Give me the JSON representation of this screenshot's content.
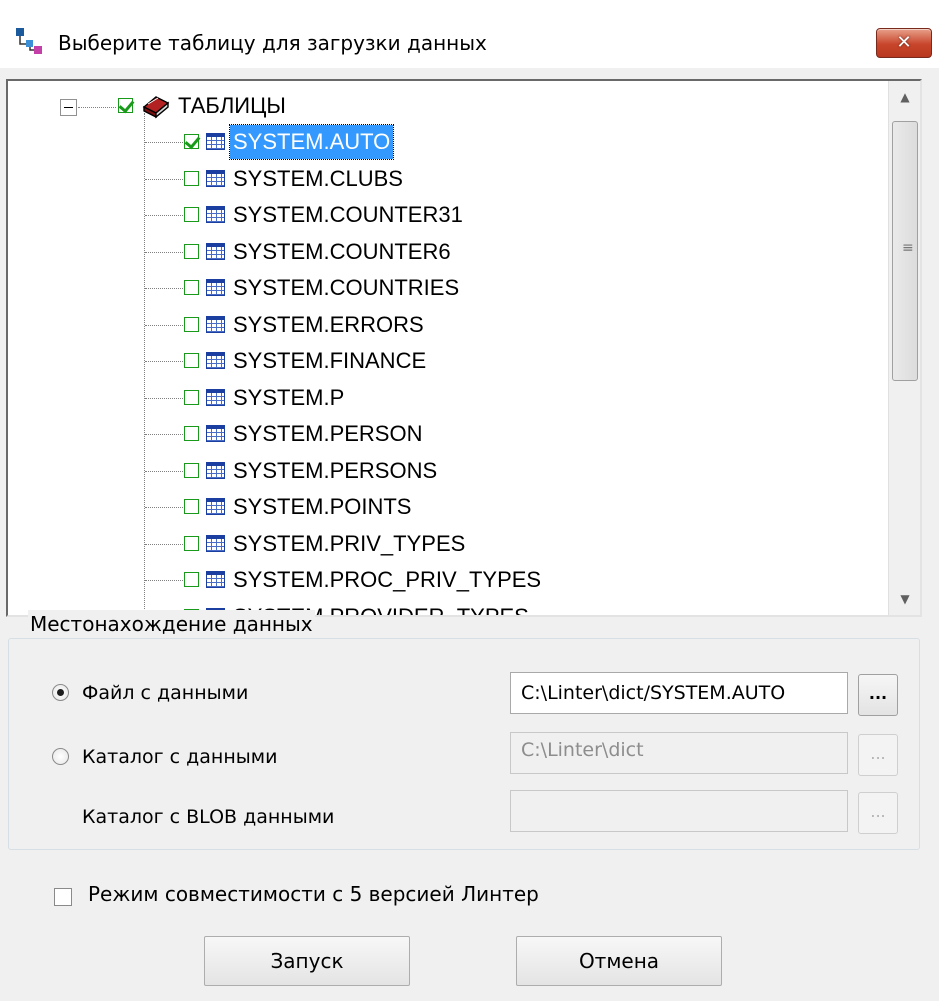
{
  "window": {
    "title": "Выберите таблицу для загрузки данных",
    "close_symbol": "✕"
  },
  "tree": {
    "root_label": "ТАБЛИЦЫ",
    "items": [
      {
        "label": "SYSTEM.AUTO",
        "checked": true,
        "selected": true
      },
      {
        "label": "SYSTEM.CLUBS",
        "checked": false,
        "selected": false
      },
      {
        "label": "SYSTEM.COUNTER31",
        "checked": false,
        "selected": false
      },
      {
        "label": "SYSTEM.COUNTER6",
        "checked": false,
        "selected": false
      },
      {
        "label": "SYSTEM.COUNTRIES",
        "checked": false,
        "selected": false
      },
      {
        "label": "SYSTEM.ERRORS",
        "checked": false,
        "selected": false
      },
      {
        "label": "SYSTEM.FINANCE",
        "checked": false,
        "selected": false
      },
      {
        "label": "SYSTEM.P",
        "checked": false,
        "selected": false
      },
      {
        "label": "SYSTEM.PERSON",
        "checked": false,
        "selected": false
      },
      {
        "label": "SYSTEM.PERSONS",
        "checked": false,
        "selected": false
      },
      {
        "label": "SYSTEM.POINTS",
        "checked": false,
        "selected": false
      },
      {
        "label": "SYSTEM.PRIV_TYPES",
        "checked": false,
        "selected": false
      },
      {
        "label": "SYSTEM.PROC_PRIV_TYPES",
        "checked": false,
        "selected": false
      },
      {
        "label": "SYSTEM.PROVIDER_TYPES",
        "checked": false,
        "selected": false
      }
    ]
  },
  "location": {
    "group_title": "Местонахождение данных",
    "file_label": "Файл с данными",
    "file_value": "C:\\Linter\\dict/SYSTEM.AUTO",
    "catalog_label": "Каталог с данными",
    "catalog_value": "C:\\Linter\\dict",
    "blob_label": "Каталог с BLOB данными",
    "blob_value": "",
    "browse_label": "...",
    "selected_source": "file"
  },
  "compat": {
    "label": "Режим совместимости с 5 версией Линтер",
    "checked": false
  },
  "buttons": {
    "run": "Запуск",
    "cancel": "Отмена"
  }
}
